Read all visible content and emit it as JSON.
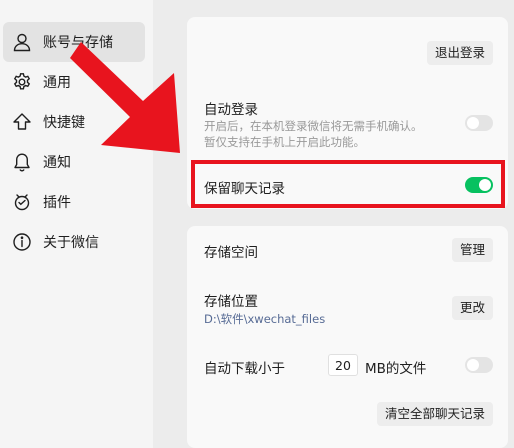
{
  "sidebar": {
    "items": [
      {
        "label": "账号与存储",
        "icon": "person-icon"
      },
      {
        "label": "通用",
        "icon": "gear-icon"
      },
      {
        "label": "快捷键",
        "icon": "up-arrow-icon"
      },
      {
        "label": "通知",
        "icon": "bell-icon"
      },
      {
        "label": "插件",
        "icon": "plugin-icon"
      },
      {
        "label": "关于微信",
        "icon": "info-icon"
      }
    ],
    "active": "账号与存储"
  },
  "account": {
    "logout_label": "退出登录",
    "auto_login": {
      "title": "自动登录",
      "desc1": "开启后，在本机登录微信将无需手机确认。",
      "desc2": "暂仅支持在手机上开启此功能。",
      "enabled": false
    },
    "keep_history": {
      "title": "保留聊天记录",
      "enabled": true
    }
  },
  "storage": {
    "space_label": "存储空间",
    "manage_label": "管理",
    "location_label": "存储位置",
    "location_path": "D:\\软件\\xwechat_files",
    "change_label": "更改",
    "auto_download_prefix": "自动下载小于",
    "auto_download_value": "20",
    "auto_download_suffix": "MB的文件",
    "auto_download_enabled": false,
    "clear_all_label": "清空全部聊天记录"
  },
  "colors": {
    "accent_green": "#07c160",
    "highlight_red": "#e8141e",
    "path_blue": "#576b95"
  }
}
